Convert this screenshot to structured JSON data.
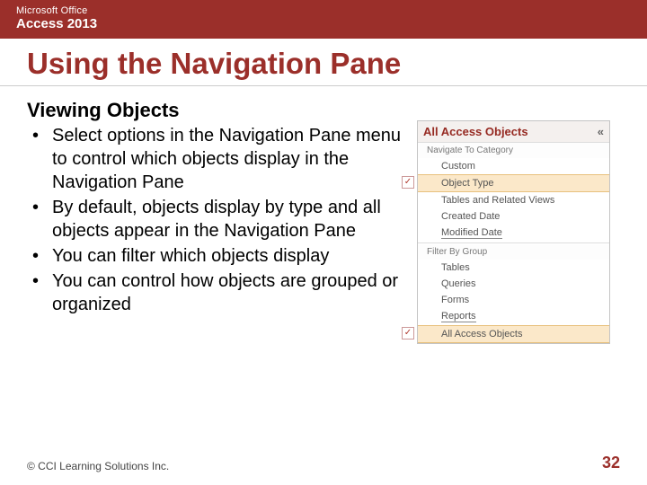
{
  "header": {
    "brand": "Microsoft Office",
    "product": "Access 2013"
  },
  "title": "Using the Navigation Pane",
  "subheading": "Viewing Objects",
  "bullets": [
    "Select options in the Navigation Pane menu to control which objects display in the Navigation Pane",
    "By default, objects display by type and all objects appear in the Navigation Pane",
    "You can filter which objects display",
    "You can control how objects are grouped or organized"
  ],
  "navpane": {
    "header": "All Access Objects",
    "chevron": "«",
    "section_category": "Navigate To Category",
    "items_category": [
      {
        "label": "Custom",
        "checked": false
      },
      {
        "label": "Object Type",
        "checked": true,
        "selected": true
      },
      {
        "label": "Tables and Related Views",
        "checked": false
      },
      {
        "label": "Created Date",
        "checked": false
      },
      {
        "label": "Modified Date",
        "checked": false,
        "underline": true
      }
    ],
    "section_filter": "Filter By Group",
    "items_filter": [
      {
        "label": "Tables",
        "checked": false
      },
      {
        "label": "Queries",
        "checked": false
      },
      {
        "label": "Forms",
        "checked": false
      },
      {
        "label": "Reports",
        "checked": false,
        "underline": true
      },
      {
        "label": "All Access Objects",
        "checked": true,
        "selected": true
      }
    ]
  },
  "footer": {
    "copyright": "© CCI Learning Solutions Inc.",
    "page": "32"
  }
}
